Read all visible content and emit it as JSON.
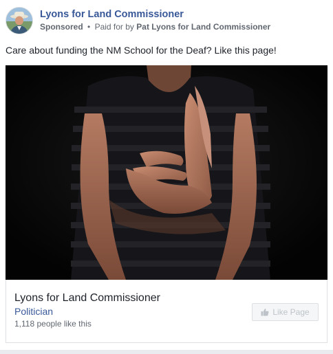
{
  "header": {
    "page_name": "Lyons for Land Commissioner",
    "sponsored_label": "Sponsored",
    "separator": "•",
    "paid_for_prefix": "Paid for by",
    "payer": "Pat Lyons for Land Commissioner"
  },
  "post": {
    "text": "Care about funding the NM School for the Deaf? Like this page!"
  },
  "card": {
    "page_name": "Lyons for Land Commissioner",
    "category": "Politician",
    "likes_text": "1,118 people like this",
    "like_button_label": "Like Page",
    "like_button_icon": "thumbs-up-icon"
  },
  "colors": {
    "link_blue": "#385898",
    "secondary_text": "#616770",
    "primary_text": "#1d2129",
    "border": "#dddfe2",
    "disabled_button_text": "#bec3c9"
  }
}
